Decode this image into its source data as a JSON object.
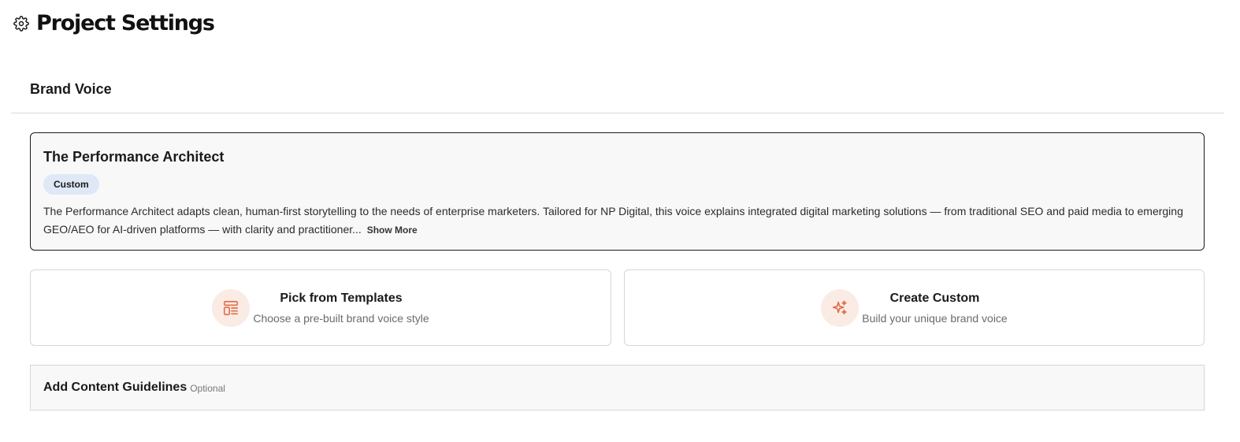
{
  "header": {
    "title": "Project Settings",
    "icon": "gear-icon"
  },
  "brand_voice": {
    "section_title": "Brand Voice",
    "current": {
      "name": "The Performance Architect",
      "badge": "Custom",
      "description": "The Performance Architect adapts clean, human-first storytelling to the needs of enterprise marketers. Tailored for NP Digital, this voice explains integrated digital marketing solutions — from traditional SEO and paid media to emerging GEO/AEO for AI-driven platforms — with clarity and practitioner...",
      "show_more_label": "Show More"
    },
    "options": [
      {
        "title": "Pick from Templates",
        "subtitle": "Choose a pre-built brand voice style",
        "icon": "template-icon"
      },
      {
        "title": "Create Custom",
        "subtitle": "Build your unique brand voice",
        "icon": "sparkle-icon"
      }
    ]
  },
  "guidelines": {
    "title": "Add Content Guidelines",
    "optional_label": "Optional"
  },
  "colors": {
    "accent": "#e0704a",
    "accent_bg": "#fbebe5",
    "badge_bg": "#dfe8f7"
  }
}
